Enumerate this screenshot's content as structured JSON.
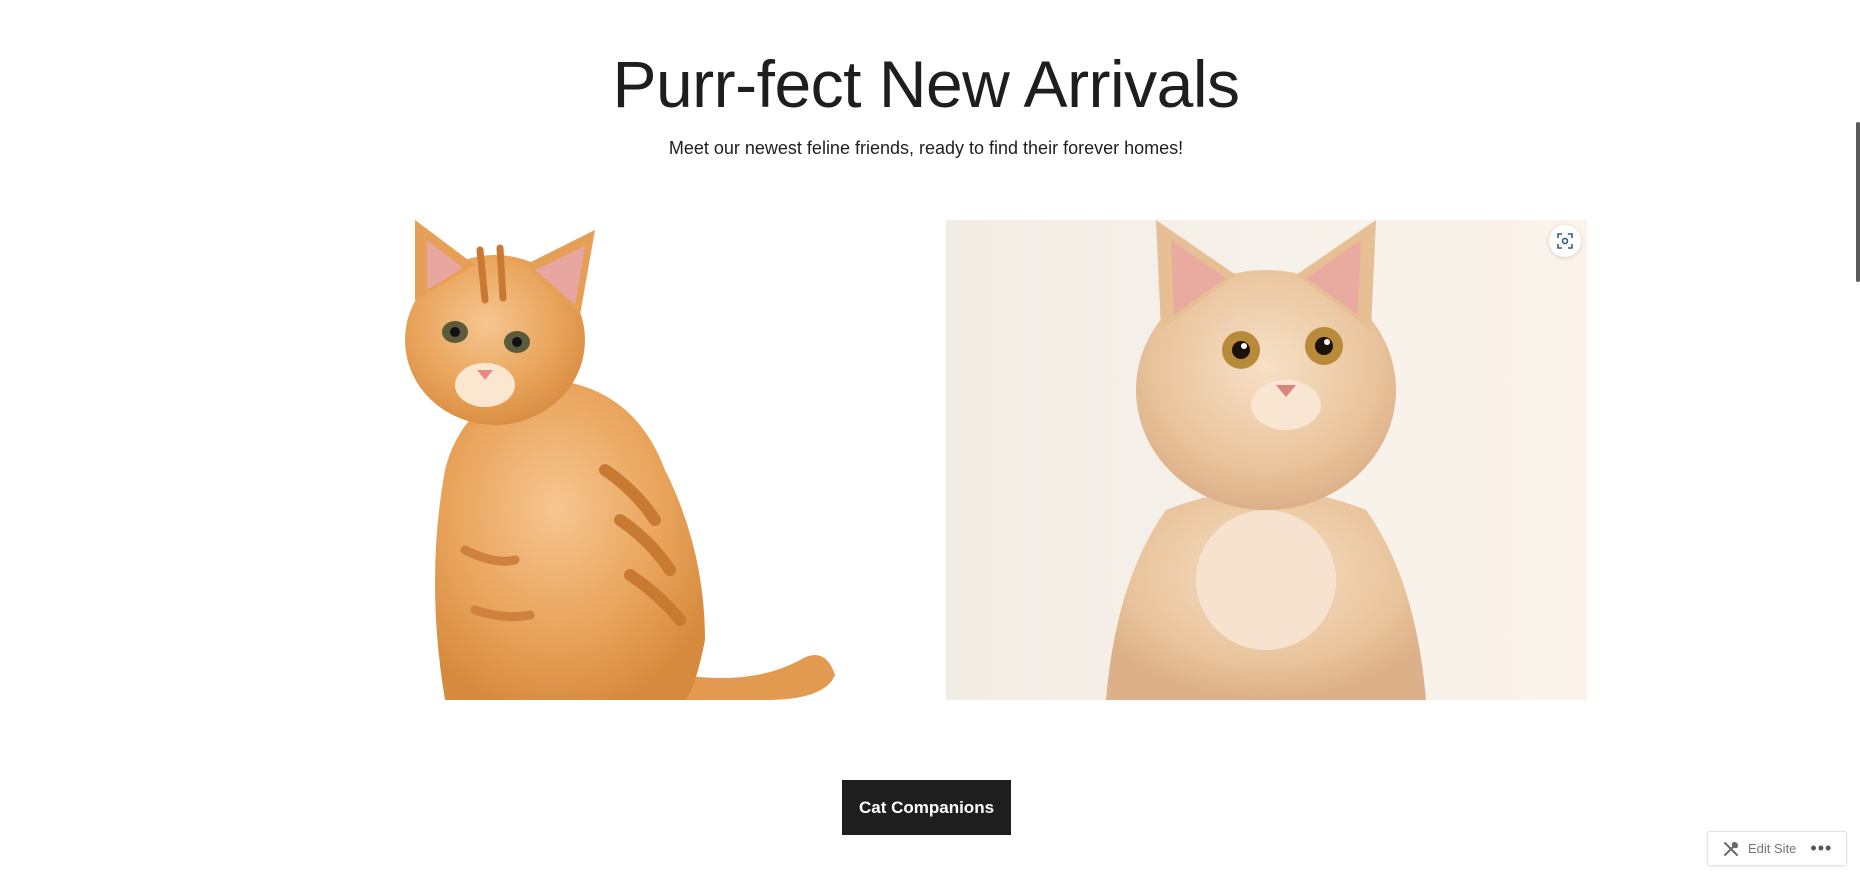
{
  "header": {
    "title": "Purr-fect New Arrivals",
    "subtitle": "Meet our newest feline friends, ready to find their forever homes!"
  },
  "gallery": {
    "images": [
      {
        "subject": "orange tabby kitten sitting, white background"
      },
      {
        "subject": "cream fluffy kitten portrait, cream background"
      }
    ],
    "zoom_icon": "zoom-icon"
  },
  "cta": {
    "label": "Cat Companions"
  },
  "admin_bar": {
    "edit_label": "Edit Site",
    "edit_icon": "tools-icon",
    "more_icon": "ellipsis-icon",
    "more_label": "•••"
  },
  "colors": {
    "text": "#1e1e1e",
    "button_bg": "#1e1e1e",
    "button_text": "#ffffff"
  }
}
